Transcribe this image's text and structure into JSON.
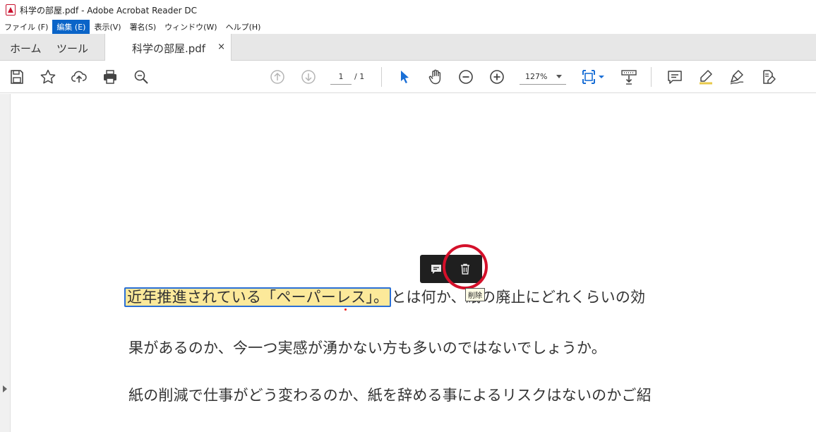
{
  "window": {
    "title": "科学の部屋.pdf - Adobe Acrobat Reader DC",
    "app_icon": "acrobat-pdf-icon"
  },
  "menu": {
    "items": [
      "ファイル (F)",
      "編集 (E)",
      "表示(V)",
      "署名(S)",
      "ウィンドウ(W)",
      "ヘルプ(H)"
    ],
    "active_index": 1,
    "active_color": "#0a64c8"
  },
  "tabs": {
    "home": "ホーム",
    "tools": "ツール",
    "document": "科学の部屋.pdf",
    "close": "×"
  },
  "toolbar": {
    "icons": [
      "save-icon",
      "star-icon",
      "upload-icon",
      "print-icon",
      "zoom-search-icon",
      "prev-page-icon",
      "next-page-icon",
      "select-cursor-icon",
      "hand-icon",
      "zoom-out-icon",
      "zoom-in-icon",
      "fit-page-icon",
      "scroll-mode-icon",
      "comment-icon",
      "highlight-icon",
      "sign-icon",
      "fill-sign-icon"
    ],
    "page_current": "1",
    "page_total": "/ 1",
    "zoom": "127%",
    "accent_color": "#1a6fd6"
  },
  "document": {
    "highlighted_text": "近年推進されている「ペーパーレス」。",
    "line1_rest": "とは何か、紙の廃止にどれくらいの効",
    "line2": "果があるのか、今一つ実感が湧かない方も多いのではないでしょうか。",
    "line3": "紙の削減で仕事がどう変わるのか、紙を辞める事によるリスクはないのかご紹",
    "highlight_color": "#fce99a",
    "selection_border_color": "#2a6fd6"
  },
  "popup": {
    "buttons": [
      "comment-icon",
      "trash-icon"
    ],
    "tooltip": "削除",
    "callout_color": "#d4102a"
  }
}
